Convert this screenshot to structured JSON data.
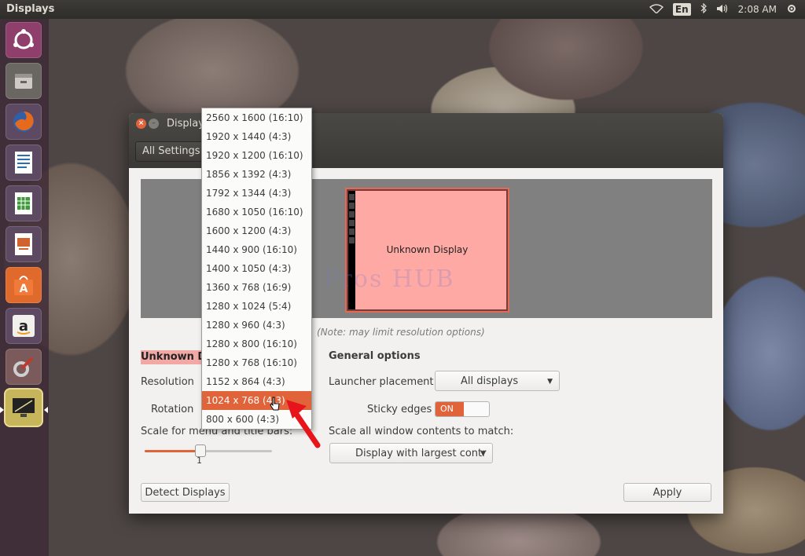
{
  "top_panel": {
    "app_title": "Displays",
    "keyboard_layout": "En",
    "clock": "2:08 AM",
    "icons": [
      "wifi-icon",
      "keyboard-indicator",
      "bluetooth-icon",
      "volume-icon"
    ]
  },
  "launcher": {
    "items": [
      {
        "name": "dash-icon",
        "glyph": "◎",
        "color": "#c9c4c2"
      },
      {
        "name": "files-icon",
        "glyph": "▭",
        "color": "#8a8580"
      },
      {
        "name": "firefox-icon",
        "glyph": "●",
        "color": "#e56a1e"
      },
      {
        "name": "writer-icon",
        "glyph": "≣",
        "color": "#2a6fb4"
      },
      {
        "name": "calc-icon",
        "glyph": "▦",
        "color": "#3f9a3a"
      },
      {
        "name": "impress-icon",
        "glyph": "▣",
        "color": "#d1632e"
      },
      {
        "name": "software-center-icon",
        "glyph": "A",
        "color": "#e06a2c"
      },
      {
        "name": "amazon-icon",
        "glyph": "a",
        "color": "#e8e6e3"
      },
      {
        "name": "system-settings-icon",
        "glyph": "✎",
        "color": "#b8442f"
      },
      {
        "name": "displays-icon",
        "glyph": "◺",
        "color": "#c6b55a"
      }
    ]
  },
  "window": {
    "title": "Display",
    "all_settings": "All Settings",
    "watermark": "IT Pros HUB",
    "monitor_label": "Unknown Display",
    "note": "(Note: may limit resolution options)",
    "display_name": "Unknown Di",
    "resolution_label": "Resolution",
    "rotation_label": "Rotation",
    "scale_label": "Scale for menu and title bars:",
    "scale_value": "1",
    "scale_level": 0.45,
    "general_options": "General options",
    "launcher_placement_label": "Launcher placement",
    "launcher_placement_value": "All displays",
    "sticky_edges_label": "Sticky edges",
    "sticky_edges_value": "ON",
    "scale_all_label": "Scale all window contents to match:",
    "scale_all_value": "Display with largest contr",
    "detect_displays": "Detect Displays",
    "apply": "Apply"
  },
  "resolution_menu": {
    "selected_index": 15,
    "options": [
      "2560 x 1600 (16:10)",
      "1920 x 1440 (4:3)",
      "1920 x 1200 (16:10)",
      "1856 x 1392 (4:3)",
      "1792 x 1344 (4:3)",
      "1680 x 1050 (16:10)",
      "1600 x 1200 (4:3)",
      "1440 x 900 (16:10)",
      "1400 x 1050 (4:3)",
      "1360 x 768 (16:9)",
      "1280 x 1024 (5:4)",
      "1280 x 960 (4:3)",
      "1280 x 800 (16:10)",
      "1280 x 768 (16:10)",
      "1152 x 864 (4:3)",
      "1024 x 768 (4:3)",
      "800 x 600 (4:3)"
    ]
  },
  "colors": {
    "accent": "#e0633a",
    "monitor_fill": "#ffa9a5",
    "panel": "#3c3b37"
  }
}
